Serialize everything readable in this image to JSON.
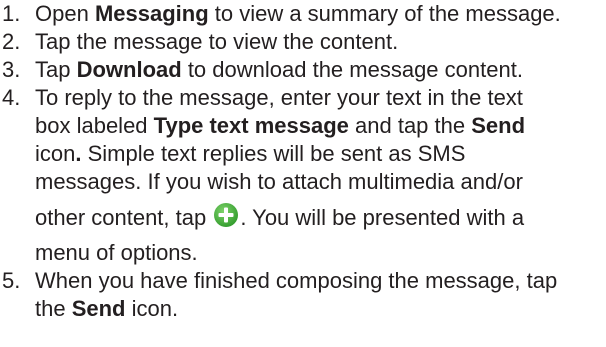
{
  "steps": [
    {
      "number": "1.",
      "pre": "Open ",
      "bold": "Messaging",
      "post": " to view a summary of the message."
    },
    {
      "number": "2.",
      "text": "Tap the message to view the content."
    },
    {
      "number": "3.",
      "pre": "Tap ",
      "bold": "Download",
      "post": " to download the message content."
    },
    {
      "number": "4.",
      "line1": "To reply to the message, enter your text in the text",
      "line2_pre": "box labeled ",
      "line2_bold1": "Type text message",
      "line2_mid": " and tap the ",
      "line2_bold2": "Send",
      "line3_pre": "icon",
      "line3_bold": ".",
      "line3_post": " Simple text replies will be sent as SMS",
      "line4": "messages. If you wish to attach multimedia and/or",
      "line5_pre": "other content, tap ",
      "line5_post": ". You will be presented with a",
      "line6": "menu of options."
    },
    {
      "number": "5.",
      "line1": "When you have finished composing the message, tap",
      "line2_pre": "the ",
      "line2_bold": "Send",
      "line2_post": " icon."
    }
  ],
  "icons": {
    "add": "add-plus-icon"
  },
  "colors": {
    "text": "#231f20",
    "icon_green": "#3aa935"
  }
}
